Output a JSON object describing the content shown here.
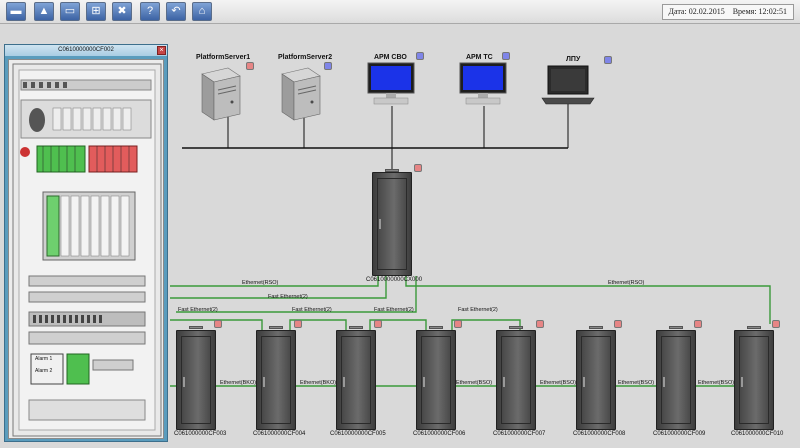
{
  "toolbar": {
    "buttons": [
      {
        "id": "tb1",
        "icon": "alarm-icon",
        "glyph": "▬",
        "color": "#c0392b"
      },
      {
        "id": "tb2",
        "icon": "chart-icon",
        "glyph": "▲"
      },
      {
        "id": "tb3",
        "icon": "window-icon",
        "glyph": "▭"
      },
      {
        "id": "tb4",
        "icon": "network-icon",
        "glyph": "⊞"
      },
      {
        "id": "tb5",
        "icon": "tools-icon",
        "glyph": "✖"
      },
      {
        "id": "tb6",
        "icon": "help-icon",
        "glyph": "?"
      },
      {
        "id": "tb7",
        "icon": "back-icon",
        "glyph": "↶"
      },
      {
        "id": "tb8",
        "icon": "home-icon",
        "glyph": "⌂"
      }
    ],
    "date_label": "Дата:",
    "date_value": "02.02.2015",
    "time_label": "Время:",
    "time_value": "12:02:51"
  },
  "cabinet_window": {
    "title": "C0610000000CF002",
    "close_glyph": "×",
    "alarm_labels": [
      "Alarm 1",
      "Alarm 2"
    ]
  },
  "workstations": [
    {
      "name": "PlatformServer1",
      "status": "red",
      "kind": "server"
    },
    {
      "name": "PlatformServer2",
      "status": "blue",
      "kind": "server"
    },
    {
      "name": "АРМ СВО",
      "status": "blue",
      "kind": "monitor"
    },
    {
      "name": "АРМ ТС",
      "status": "blue",
      "kind": "monitor"
    },
    {
      "name": "ЛПУ",
      "status": "",
      "kind": "laptop"
    }
  ],
  "main_cabinet": {
    "name": "C0610000000CX000",
    "status": "red"
  },
  "cabinets": [
    {
      "name": "C061000000CF003",
      "status": "red"
    },
    {
      "name": "C061000000CF004",
      "status": "red"
    },
    {
      "name": "C0610000000CF005",
      "status": "red"
    },
    {
      "name": "C061000000CF006",
      "status": "red"
    },
    {
      "name": "C061000000CF007",
      "status": "red"
    },
    {
      "name": "C061000000CF008",
      "status": "red"
    },
    {
      "name": "C061000000CF009",
      "status": "red"
    },
    {
      "name": "C061000000CF010",
      "status": "red"
    }
  ],
  "links": {
    "ethernet_rso": "Ethernet(RSO)",
    "fast_ethernet": "Fast Ethernet(2)",
    "ethernet_bko": "Ethernet(BKO)",
    "ethernet_bso": "Ethernet(BSO)"
  },
  "colors": {
    "link_green": "#3a9a3a",
    "status_red": "#e68585",
    "status_blue": "#7f85e8",
    "window_frame": "#5a9cbd"
  }
}
